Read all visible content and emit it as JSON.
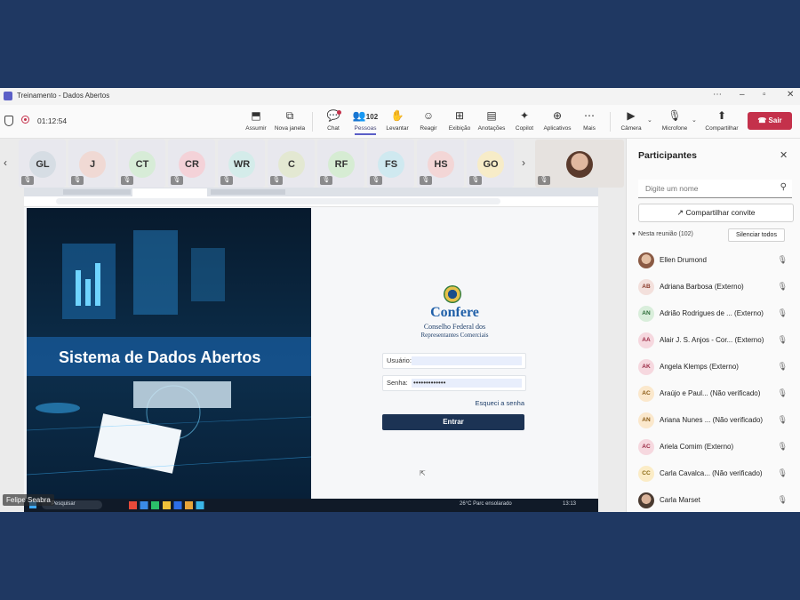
{
  "window": {
    "title": "Treinamento - Dados Abertos"
  },
  "meeting": {
    "timer": "01:12:54"
  },
  "toolbar": {
    "items": [
      {
        "name": "assumir",
        "label": "Assumir",
        "icon": "⬒"
      },
      {
        "name": "nova-janela",
        "label": "Nova janela",
        "icon": "⧉"
      },
      {
        "name": "chat",
        "label": "Chat",
        "icon": "💬"
      },
      {
        "name": "pessoas",
        "label": "Pessoas",
        "icon": "👥",
        "badge": "102"
      },
      {
        "name": "levantar",
        "label": "Levantar",
        "icon": "✋"
      },
      {
        "name": "reagir",
        "label": "Reagir",
        "icon": "☺"
      },
      {
        "name": "exibicao",
        "label": "Exibição",
        "icon": "⊞"
      },
      {
        "name": "anotacoes",
        "label": "Anotações",
        "icon": "▤"
      },
      {
        "name": "copilot",
        "label": "Copilot",
        "icon": "✦"
      },
      {
        "name": "aplicativos",
        "label": "Aplicativos",
        "icon": "⊕"
      },
      {
        "name": "mais",
        "label": "Mais",
        "icon": "⋯"
      },
      {
        "name": "camera",
        "label": "Câmera",
        "icon": "▶"
      },
      {
        "name": "microfone",
        "label": "Microfone",
        "icon": "🎙"
      },
      {
        "name": "compartilhar",
        "label": "Compartilhar",
        "icon": "⬆"
      }
    ],
    "leave_label": "Sair"
  },
  "strip": {
    "tiles": [
      {
        "initials": "GL",
        "color": "#d6dde4"
      },
      {
        "initials": "J",
        "color": "#f0d9d4"
      },
      {
        "initials": "CT",
        "color": "#d7ecd7"
      },
      {
        "initials": "CR",
        "color": "#f4d2d8"
      },
      {
        "initials": "WR",
        "color": "#d4ecea"
      },
      {
        "initials": "C",
        "color": "#e3e8d2"
      },
      {
        "initials": "RF",
        "color": "#d6ecd3"
      },
      {
        "initials": "FS",
        "color": "#cfe9f0"
      },
      {
        "initials": "HS",
        "color": "#f3d6d6"
      },
      {
        "initials": "GO",
        "color": "#f7ecc8"
      }
    ],
    "presenter_name": "Felipe Seabra"
  },
  "shared": {
    "hero_title": "Sistema de Dados Abertos",
    "brand": "Confere",
    "brand_sub1": "Conselho Federal dos",
    "brand_sub2": "Representantes Comerciais",
    "user_label": "Usuário:",
    "user_value": "",
    "pass_label": "Senha:",
    "pass_value": "•••••••••••••",
    "forgot": "Esqueci a senha",
    "submit": "Entrar",
    "search_placeholder": "Pesquisar",
    "weather": "26°C  Parc ensolarado",
    "clock": "13:13"
  },
  "panel": {
    "title": "Participantes",
    "search_placeholder": "Digite um nome",
    "share_invite": "Compartilhar convite",
    "section_label": "Nesta reunião (102)",
    "mute_all": "Silenciar todos",
    "people": [
      {
        "initials": "",
        "name": "Ellen Drumond",
        "color": "#8a5a44",
        "photo": true
      },
      {
        "initials": "AB",
        "name": "Adriana Barbosa (Externo)",
        "color": "#f3e0dc"
      },
      {
        "initials": "AN",
        "name": "Adrião Rodrigues de ...  (Externo)",
        "color": "#d9eedb"
      },
      {
        "initials": "AA",
        "name": "Alair J. S. Anjos - Cor...  (Externo)",
        "color": "#f6d8df"
      },
      {
        "initials": "AK",
        "name": "Angela Klemps (Externo)",
        "color": "#f6d8df"
      },
      {
        "initials": "AC",
        "name": "Araújo e Paul...  (Não verificado)",
        "color": "#fbe8cc"
      },
      {
        "initials": "AN",
        "name": "Ariana Nunes ...  (Não verificado)",
        "color": "#fbe8cc"
      },
      {
        "initials": "AC",
        "name": "Ariela Comim (Externo)",
        "color": "#f6d8df"
      },
      {
        "initials": "CC",
        "name": "Carla Cavalca...  (Não verificado)",
        "color": "#fbecc6"
      },
      {
        "initials": "",
        "name": "Carla Marset",
        "color": "#5a4a3f",
        "photo": true
      }
    ]
  }
}
